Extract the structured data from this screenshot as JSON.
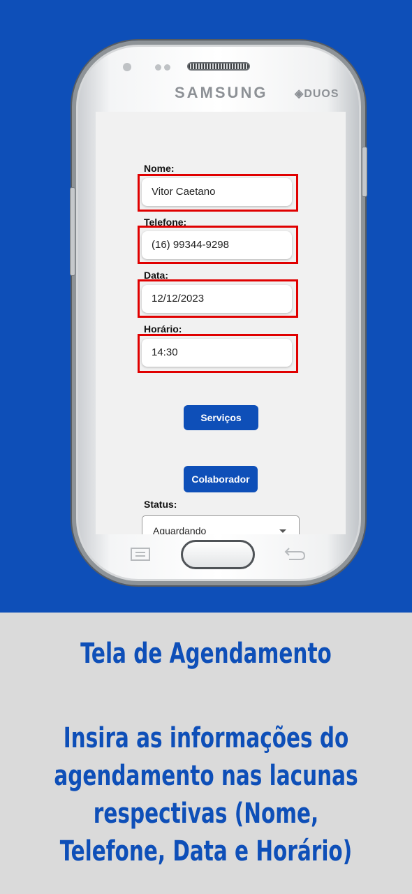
{
  "device": {
    "brand": "SAMSUNG",
    "model_badge": "DUOS"
  },
  "form": {
    "fields": [
      {
        "label": "Nome:",
        "value": "Vitor Caetano"
      },
      {
        "label": "Telefone:",
        "value": "(16) 99344-9298"
      },
      {
        "label": "Data:",
        "value": "12/12/2023"
      },
      {
        "label": "Horário:",
        "value": "14:30"
      }
    ],
    "services_button": "Serviços",
    "collaborator_button": "Colaborador",
    "status_label": "Status:",
    "status_value": "Aguardando"
  },
  "caption": {
    "title": "Tela de Agendamento",
    "instruction": "Insira as informações do agendamento nas lacunas respectivas (Nome, Telefone, Data e Horário)"
  },
  "colors": {
    "background_blue": "#0e4fb8",
    "caption_background": "#dadada",
    "highlight": "#e00000"
  }
}
